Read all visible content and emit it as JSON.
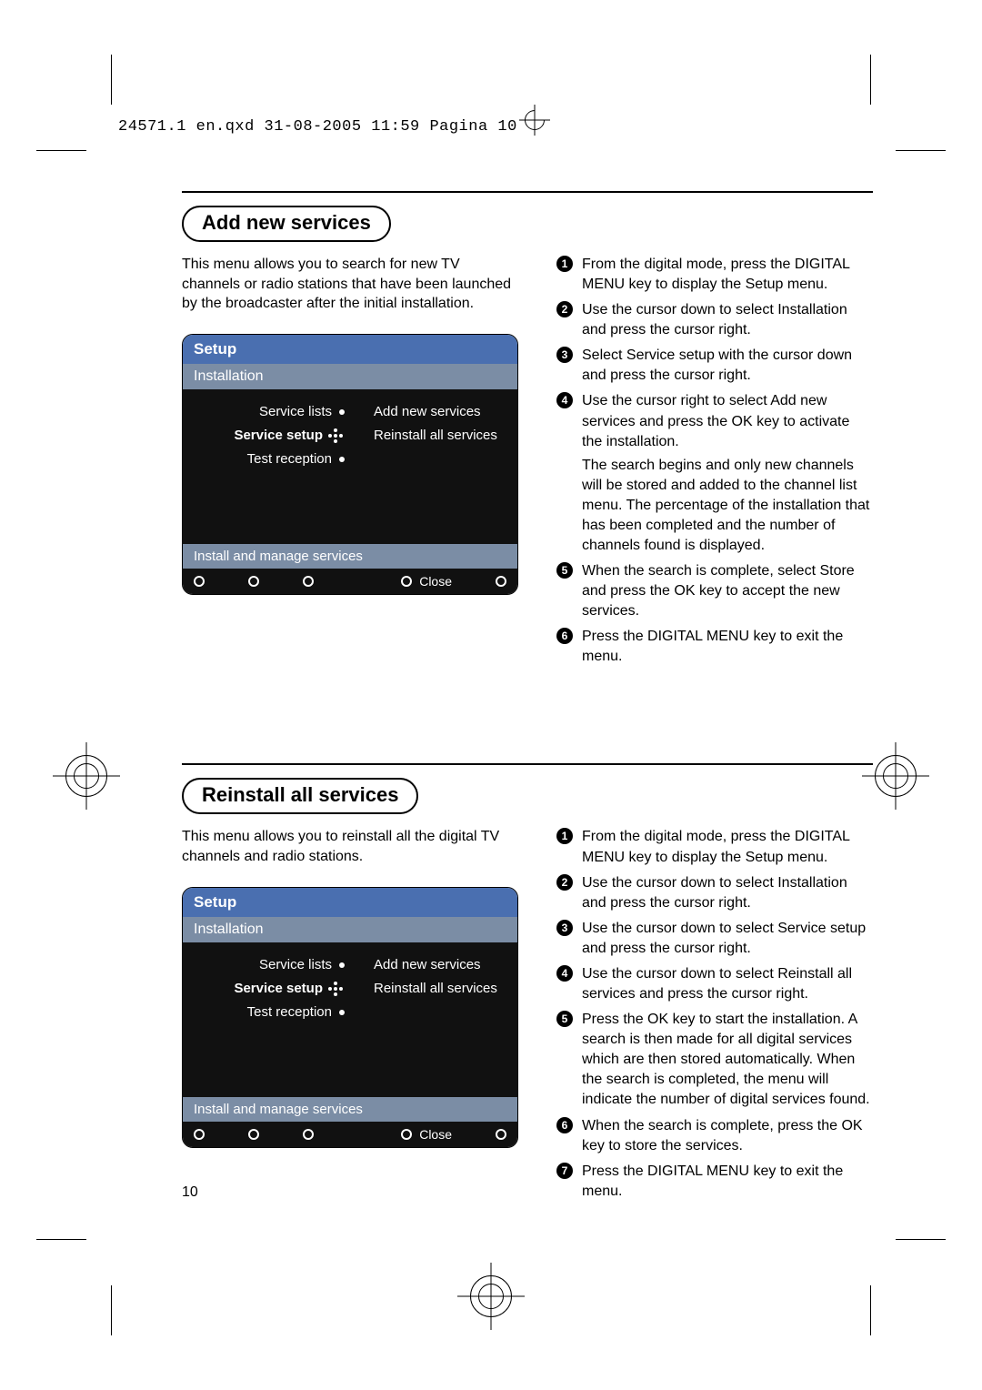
{
  "header": "24571.1 en.qxd  31-08-2005  11:59  Pagina 10",
  "page_number": "10",
  "sections": [
    {
      "title": "Add new services",
      "intro": "This menu allows you to search for new TV channels or radio stations that have been launched by the broadcaster after the initial installation.",
      "setup": {
        "title": "Setup",
        "subtitle": "Installation",
        "left": [
          "Service lists",
          "Service setup",
          "Test reception"
        ],
        "right": [
          "Add new services",
          "Reinstall all services"
        ],
        "hint": "Install and manage services",
        "close": "Close"
      },
      "steps": [
        [
          [
            "t",
            "From the digital mode, press the "
          ],
          [
            "b",
            "DIGITAL MENU"
          ],
          [
            "t",
            " key to display the Setup menu."
          ]
        ],
        [
          [
            "t",
            "Use the cursor down to select "
          ],
          [
            "b",
            "Installation"
          ],
          [
            "t",
            " and press the cursor right."
          ]
        ],
        [
          [
            "t",
            "Select "
          ],
          [
            "b",
            "Service setup"
          ],
          [
            "t",
            " with the cursor down and press the cursor right."
          ]
        ],
        [
          [
            "t",
            "Use the cursor right to select "
          ],
          [
            "b",
            "Add new services"
          ],
          [
            "t",
            " and press the "
          ],
          [
            "b",
            "OK"
          ],
          [
            "t",
            " key to activate the installation."
          ],
          [
            "p",
            "The search begins and only new channels will be stored and added to the channel list menu. The percentage of the installation that has been completed and the number of channels found is displayed."
          ]
        ],
        [
          [
            "t",
            "When the search is complete, select "
          ],
          [
            "b",
            "Store"
          ],
          [
            "t",
            " and press the "
          ],
          [
            "b",
            "OK"
          ],
          [
            "t",
            " key to accept the new services."
          ]
        ],
        [
          [
            "t",
            "Press the "
          ],
          [
            "b",
            "DIGITAL MENU"
          ],
          [
            "t",
            " key to exit the menu."
          ]
        ]
      ]
    },
    {
      "title": "Reinstall all services",
      "intro": "This menu allows you to reinstall all the digital TV channels and radio stations.",
      "setup": {
        "title": "Setup",
        "subtitle": "Installation",
        "left": [
          "Service lists",
          "Service setup",
          "Test reception"
        ],
        "right": [
          "Add new services",
          "Reinstall all services"
        ],
        "hint": "Install and manage services",
        "close": "Close"
      },
      "steps": [
        [
          [
            "t",
            "From the digital mode, press the "
          ],
          [
            "b",
            "DIGITAL MENU"
          ],
          [
            "t",
            " key to display the Setup menu."
          ]
        ],
        [
          [
            "t",
            "Use the cursor down to select "
          ],
          [
            "b",
            "Installation"
          ],
          [
            "t",
            " and press the cursor right."
          ]
        ],
        [
          [
            "t",
            "Use the cursor down to select "
          ],
          [
            "b",
            "Service setup"
          ],
          [
            "t",
            " and press the cursor right."
          ]
        ],
        [
          [
            "t",
            "Use the cursor down to select "
          ],
          [
            "b",
            "Reinstall all services"
          ],
          [
            "t",
            " and press the cursor right."
          ]
        ],
        [
          [
            "t",
            "Press the "
          ],
          [
            "b",
            "OK"
          ],
          [
            "t",
            " key to start the installation. A search is then made for all digital services which are then stored automatically. When the search is completed, the menu will indicate the number of digital services found."
          ]
        ],
        [
          [
            "t",
            "When the search is complete, press the "
          ],
          [
            "b",
            "OK"
          ],
          [
            "t",
            " key to store the services."
          ]
        ],
        [
          [
            "t",
            "Press the "
          ],
          [
            "b",
            "DIGITAL MENU"
          ],
          [
            "t",
            " key to exit the menu."
          ]
        ]
      ]
    }
  ]
}
